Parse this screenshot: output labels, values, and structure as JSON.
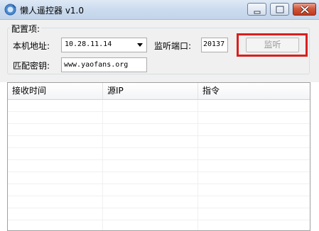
{
  "window": {
    "title": "懒人遥控器 v1.0",
    "app_icon": "remote-app-icon",
    "controls": [
      "minimize-icon",
      "maximize-icon",
      "close-icon"
    ]
  },
  "config": {
    "group_title": "配置项:",
    "local_address_label": "本机地址:",
    "local_address_value": "10.28.11.14",
    "port_label": "监听端口:",
    "port_value": "20137",
    "listen_button": "监听",
    "key_label": "匹配密钥:",
    "key_value": "www.yaofans.org"
  },
  "table": {
    "columns": [
      "接收时间",
      "源IP",
      "指令"
    ],
    "rows": []
  },
  "colors": {
    "highlight": "#d81f1f",
    "titlebar": "#cddcef",
    "panel": "#f0f0f0"
  }
}
